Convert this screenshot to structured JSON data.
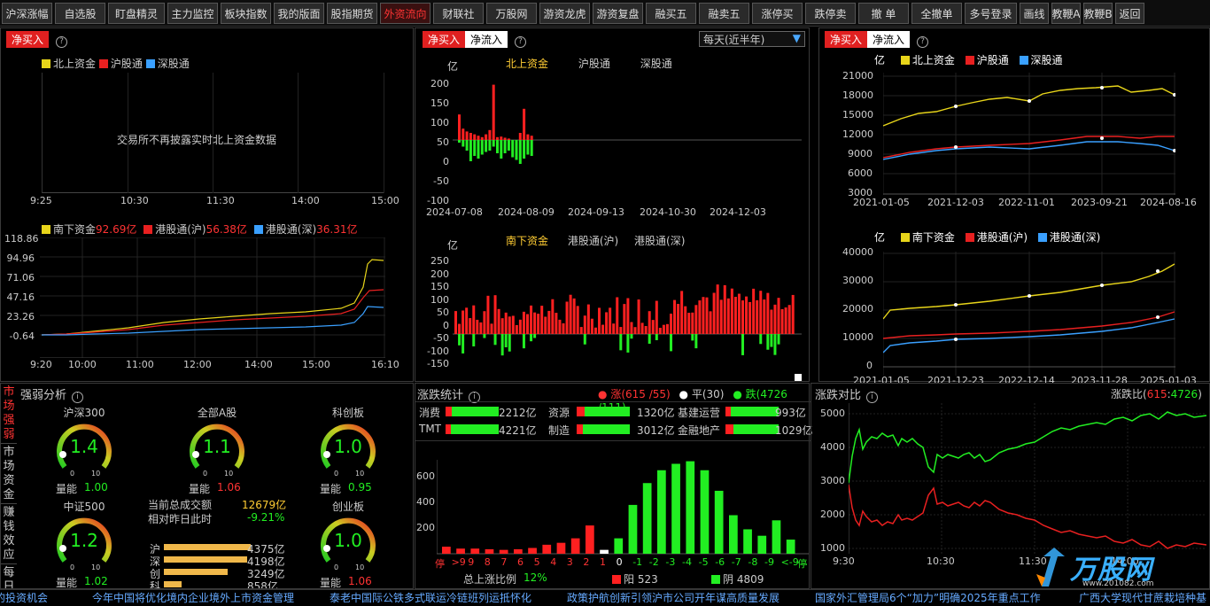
{
  "toolbar": [
    "沪深涨幅",
    "自选股",
    "盯盘精灵",
    "主力监控",
    "板块指数",
    "我的版面",
    "股指期货",
    "外资流向",
    "财联社",
    "万股网",
    "游资龙虎",
    "游资复盘",
    "融买五",
    "融卖五",
    "涨停买",
    "跌停卖",
    "撤 单",
    "全撤单",
    "多号登录",
    "画线",
    "教鞭A",
    "教鞭B",
    "返回"
  ],
  "active_tab": "外资流向",
  "colors": {
    "north": "#e8d51a",
    "sh": "#e82020",
    "sz": "#3aa0ff",
    "up": "#ff2020",
    "down": "#22ee22"
  },
  "p1": {
    "btn": "净买入",
    "help": "?",
    "legend": [
      "北上资金",
      "沪股通",
      "深股通"
    ],
    "msg": "交易所不再披露实时北上资金数据",
    "xticks": [
      "9:25",
      "10:30",
      "11:30",
      "14:00",
      "15:00"
    ],
    "south_legend": [
      {
        "name": "南下资金",
        "val": "92.69亿"
      },
      {
        "name": "港股通(沪)",
        "val": "56.38亿"
      },
      {
        "name": "港股通(深)",
        "val": "36.31亿"
      }
    ],
    "yticks": [
      "118.86",
      "94.96",
      "71.06",
      "47.16",
      "23.26",
      "-0.64"
    ],
    "xticks2": [
      "9:20",
      "10:00",
      "11:00",
      "12:00",
      "14:00",
      "15:00",
      "16:10"
    ]
  },
  "p2": {
    "btn1": "净买入",
    "btn2": "净流入",
    "help": "?",
    "select": "每天(近半年)",
    "unit": "亿",
    "legend1": [
      "北上资金",
      "沪股通",
      "深股通"
    ],
    "yticks1": [
      "200",
      "150",
      "100",
      "50",
      "0",
      "-50",
      "-100"
    ],
    "xticks1": [
      "2024-07-08",
      "2024-08-09",
      "2024-09-13",
      "2024-10-30",
      "2024-12-03"
    ],
    "legend2": [
      "南下资金",
      "港股通(沪)",
      "港股通(深)"
    ],
    "yticks2": [
      "250",
      "200",
      "150",
      "100",
      "50",
      "0",
      "-50",
      "-100",
      "-150"
    ]
  },
  "p3": {
    "btn1": "净买入",
    "btn2": "净流入",
    "help": "?",
    "unit": "亿",
    "legend1": [
      "北上资金",
      "沪股通",
      "深股通"
    ],
    "yticks1": [
      "21000",
      "18000",
      "15000",
      "12000",
      "9000",
      "6000",
      "3000"
    ],
    "xticks1": [
      "2021-01-05",
      "2021-12-03",
      "2022-11-01",
      "2023-09-21",
      "2024-08-16"
    ],
    "legend2": [
      "南下资金",
      "港股通(沪)",
      "港股通(深)"
    ],
    "yticks2": [
      "40000",
      "30000",
      "20000",
      "10000",
      "0"
    ],
    "xticks2": [
      "2021-01-05",
      "2021-12-23",
      "2022-12-14",
      "2023-11-28",
      "2025-01-03"
    ]
  },
  "strength": {
    "tabs": [
      "市场强弱",
      "市场资金",
      "赚钱效应",
      "每日"
    ],
    "title": "强弱分析",
    "gauges": [
      {
        "name": "沪深300",
        "value": "1.4",
        "vol_label": "量能",
        "vol": "1.00"
      },
      {
        "name": "全部A股",
        "value": "1.1",
        "vol_label": "量能",
        "vol": "1.06"
      },
      {
        "name": "科创板",
        "value": "1.0",
        "vol_label": "量能",
        "vol": "0.95"
      },
      {
        "name": "中证500",
        "value": "1.2",
        "vol_label": "量能",
        "vol": "1.02"
      },
      {
        "name": "创业板",
        "value": "1.0",
        "vol_label": "量能",
        "vol": "1.06"
      }
    ],
    "scale_lo": "0",
    "scale_hi": "10",
    "turnover_label": "当前总成交额",
    "turnover": "12679亿",
    "compare_label": "相对昨日此时",
    "compare": "-9.21%",
    "markets": [
      {
        "name": "沪",
        "val": "4375亿"
      },
      {
        "name": "深",
        "val": "4198亿"
      },
      {
        "name": "创",
        "val": "3249亿"
      },
      {
        "name": "科",
        "val": "858亿"
      }
    ]
  },
  "updown": {
    "title": "涨跌统计",
    "up": "涨(615 /55)",
    "flat": "平(30)",
    "down": "跌(4726 /111)",
    "sectors": [
      {
        "name": "消费",
        "val": "2212亿",
        "r": 0.12
      },
      {
        "name": "资源",
        "val": "1320亿",
        "r": 0.15
      },
      {
        "name": "基建运营",
        "val": "993亿",
        "r": 0.1
      },
      {
        "name": "TMT",
        "val": "4221亿",
        "r": 0.1
      },
      {
        "name": "制造",
        "val": "3012亿",
        "r": 0.12
      },
      {
        "name": "金融地产",
        "val": "1029亿",
        "r": 0.15
      }
    ],
    "yticks": [
      "600",
      "400",
      "200"
    ],
    "labels": [
      "停",
      "&gt;9",
      "9",
      "8",
      "7",
      "6",
      "5",
      "4",
      "3",
      "2",
      "1",
      "0",
      "-1",
      "-2",
      "-3",
      "-4",
      "-5",
      "-6",
      "-7",
      "-8",
      "-9",
      "&lt;-9",
      "停"
    ],
    "values": [
      55,
      40,
      40,
      35,
      30,
      35,
      45,
      70,
      85,
      120,
      220,
      30,
      120,
      380,
      550,
      650,
      700,
      720,
      650,
      490,
      300,
      190,
      140,
      260,
      110
    ],
    "ratio_label": "总上涨比例",
    "ratio": "12%",
    "yang_label": "阳",
    "yang": "523",
    "yin_label": "阴",
    "yin": "4809"
  },
  "compare": {
    "title": "涨跌对比",
    "ratio_label": "涨跌比(",
    "ratio_up": "615",
    "ratio_sep": ":",
    "ratio_down": "4726",
    ")": ")",
    "yticks": [
      "5000",
      "4000",
      "3000",
      "2000",
      "1000"
    ],
    "xticks": [
      "9:30",
      "10:30",
      "11:30",
      "14:00"
    ]
  },
  "watermark": "万股网",
  "watermark_url": "www.201082.com",
  "news": [
    "的投资机会",
    "今年中国将优化境内企业境外上市资金管理",
    "泰老中国际公铁多式联运冷链班列运抵怀化",
    "政策护航创新引领沪市公司开年谋高质量发展",
    "国家外汇管理局6个“加力”明确2025年重点工作",
    "广西大学现代甘蔗栽培种基"
  ]
}
